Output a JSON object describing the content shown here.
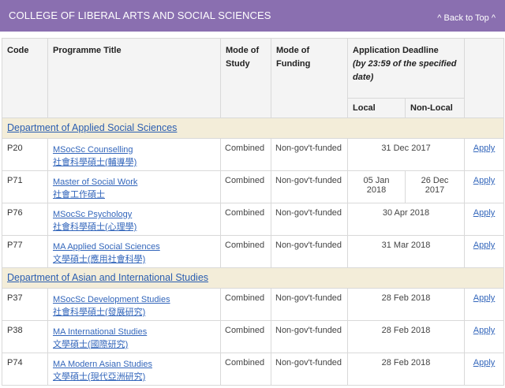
{
  "header": {
    "college": "COLLEGE OF LIBERAL ARTS AND SOCIAL SCIENCES",
    "back_to_top": "^ Back to Top ^"
  },
  "columns": {
    "code": "Code",
    "title": "Programme Title",
    "mode_study": "Mode of Study",
    "mode_funding": "Mode of Funding",
    "deadline_main": "Application Deadline",
    "deadline_note": "(by 23:59 of the specified date)",
    "local": "Local",
    "non_local": "Non-Local"
  },
  "departments": [
    {
      "name": "Department of Applied Social Sciences",
      "programmes": [
        {
          "code": "P20",
          "en": "MSocSc Counselling",
          "zh": "社會科學碩士(輔導學)",
          "study": "Combined",
          "funding": "Non-gov't-funded",
          "deadline": "31 Dec 2017",
          "apply": "Apply"
        },
        {
          "code": "P71",
          "en": "Master of Social Work",
          "zh": "社會工作碩士",
          "study": "Combined",
          "funding": "Non-gov't-funded",
          "local": "05 Jan 2018",
          "non_local": "26 Dec 2017",
          "apply": "Apply"
        },
        {
          "code": "P76",
          "en": "MSocSc Psychology",
          "zh": "社會科學碩士(心理學)",
          "study": "Combined",
          "funding": "Non-gov't-funded",
          "deadline": "30 Apr 2018",
          "apply": "Apply"
        },
        {
          "code": "P77",
          "en": "MA Applied Social Sciences",
          "zh": "文學碩士(應用社會科學)",
          "study": "Combined",
          "funding": "Non-gov't-funded",
          "deadline": "31 Mar 2018",
          "apply": "Apply"
        }
      ]
    },
    {
      "name": "Department of Asian and International Studies",
      "programmes": [
        {
          "code": "P37",
          "en": "MSocSc Development Studies",
          "zh": "社會科學碩士(發展研究)",
          "study": "Combined",
          "funding": "Non-gov't-funded",
          "deadline": "28 Feb 2018",
          "apply": "Apply"
        },
        {
          "code": "P38",
          "en": "MA International Studies",
          "zh": "文學碩士(國際研究)",
          "study": "Combined",
          "funding": "Non-gov't-funded",
          "deadline": "28 Feb 2018",
          "apply": "Apply"
        },
        {
          "code": "P74",
          "en": "MA Modern Asian Studies",
          "zh": "文學碩士(現代亞洲研究)",
          "study": "Combined",
          "funding": "Non-gov't-funded",
          "deadline": "28 Feb 2018",
          "apply": "Apply"
        }
      ]
    }
  ]
}
